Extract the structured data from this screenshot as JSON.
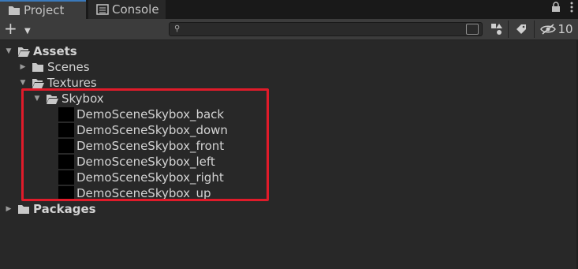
{
  "tabs": [
    {
      "label": "Project",
      "icon": "folder-icon",
      "active": true
    },
    {
      "label": "Console",
      "icon": "console-icon",
      "active": false
    }
  ],
  "toolbar": {
    "add_label": "+",
    "search_placeholder": "",
    "hidden_count": "10"
  },
  "tree": {
    "assets": "Assets",
    "scenes": "Scenes",
    "textures": "Textures",
    "skybox": "Skybox",
    "skybox_items": [
      "DemoSceneSkybox_back",
      "DemoSceneSkybox_down",
      "DemoSceneSkybox_front",
      "DemoSceneSkybox_left",
      "DemoSceneSkybox_right",
      "DemoSceneSkybox_up"
    ],
    "packages": "Packages"
  },
  "colors": {
    "background": "#282828",
    "toolbar": "#3c3c3c",
    "highlight": "#e01b2a",
    "active_tab_accent": "#3a79bb"
  }
}
